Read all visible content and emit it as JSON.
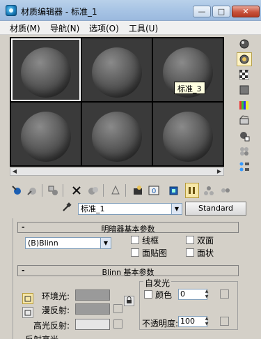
{
  "window": {
    "title": "材质编辑器 - 标准_1",
    "minimize": "—",
    "maximize": "□",
    "close": "✕"
  },
  "menu": [
    {
      "label": "材质(M)"
    },
    {
      "label": "导航(N)"
    },
    {
      "label": "选项(O)"
    },
    {
      "label": "工具(U)"
    }
  ],
  "samples": {
    "tooltip": "标准_3",
    "slots": [
      {
        "active": true
      },
      {
        "active": false
      },
      {
        "active": false
      },
      {
        "active": false
      },
      {
        "active": false
      },
      {
        "active": false
      }
    ]
  },
  "scroll": {
    "left": "◀",
    "right": "▶"
  },
  "material": {
    "name": "标准_1",
    "type_button": "Standard"
  },
  "shader_rollout": {
    "title": "明暗器基本参数",
    "shader": "(B)Blinn",
    "options": {
      "wire": "线框",
      "two_sided": "双面",
      "face_map": "面贴图",
      "faceted": "面状"
    }
  },
  "blinn_rollout": {
    "title": "Blinn 基本参数",
    "ambient": "环境光:",
    "diffuse": "漫反射:",
    "specular": "高光反射:",
    "self_illum": {
      "title": "自发光",
      "color_label": "颜色",
      "value": "0"
    },
    "opacity": {
      "label": "不透明度:",
      "value": "100"
    },
    "next_group": "反射高光"
  },
  "colors": {
    "ambient": "#9a9a9a",
    "diffuse": "#9a9a9a",
    "specular": "#e6e6e6",
    "accent": "#f6e7a8"
  }
}
